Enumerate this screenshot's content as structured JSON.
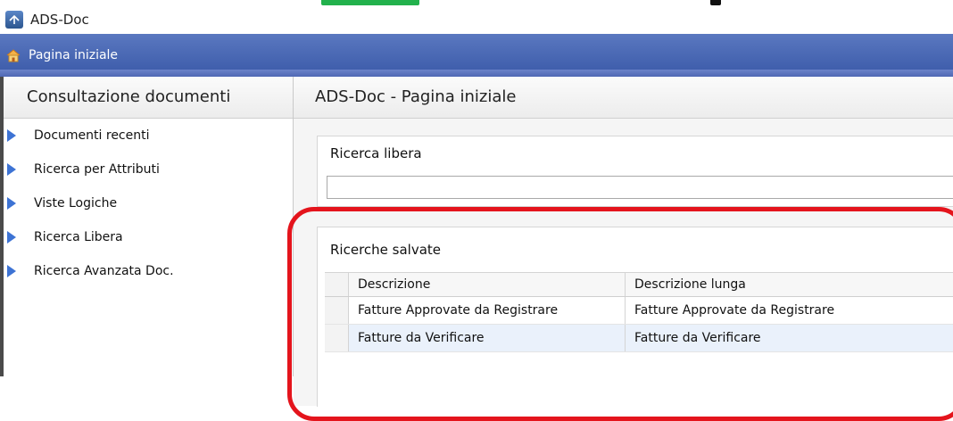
{
  "window": {
    "title": "ADS-Doc",
    "icon": "ads-doc-app-icon"
  },
  "navbar": {
    "tab_label": "Pagina iniziale",
    "tab_icon": "home-icon"
  },
  "sidebar": {
    "header": "Consultazione documenti",
    "items": [
      {
        "label": "Documenti recenti",
        "icon": "blue-arrow-icon"
      },
      {
        "label": "Ricerca per Attributi",
        "icon": "blue-arrow-icon"
      },
      {
        "label": "Viste Logiche",
        "icon": "blue-arrow-icon"
      },
      {
        "label": "Ricerca Libera",
        "icon": "blue-arrow-icon"
      },
      {
        "label": "Ricerca Avanzata Doc.",
        "icon": "blue-arrow-icon"
      }
    ]
  },
  "main": {
    "header": "ADS-Doc - Pagina iniziale",
    "free_search": {
      "title": "Ricerca libera",
      "value": "",
      "placeholder": ""
    },
    "saved_searches": {
      "title": "Ricerche salvate",
      "columns": [
        "Descrizione",
        "Descrizione lunga"
      ],
      "rows": [
        [
          "Fatture Approvate da Registrare",
          "Fatture Approvate da Registrare"
        ],
        [
          "Fatture da Verificare",
          "Fatture da Verificare"
        ]
      ]
    }
  },
  "colors": {
    "navbar": "#4a68b4",
    "arrow": "#3d73d4",
    "highlight": "#e4141c",
    "row_alt": "#eaf1fb"
  }
}
